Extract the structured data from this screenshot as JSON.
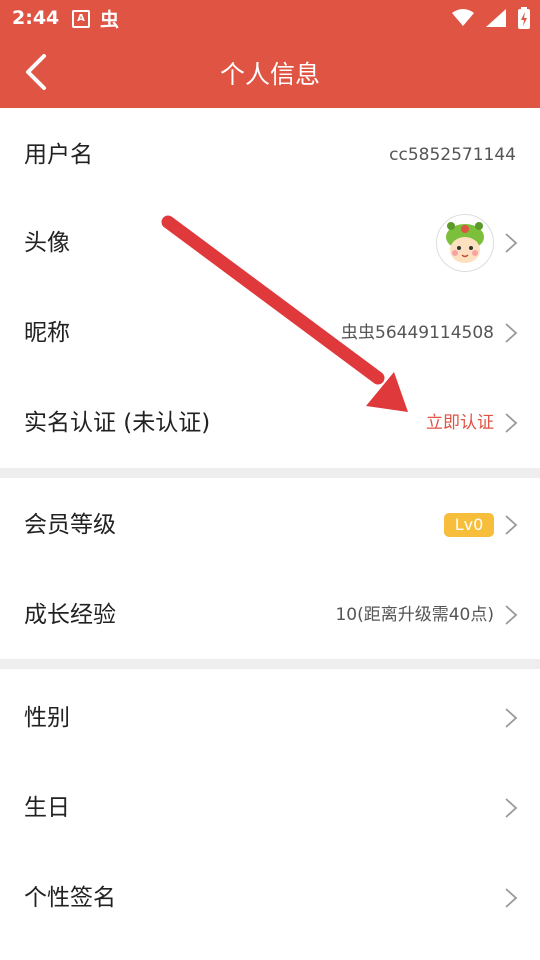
{
  "status_bar": {
    "time": "2:44",
    "app_icon_letter": "A",
    "app_icon2": "虫"
  },
  "header": {
    "title": "个人信息",
    "accent_color": "#e05444"
  },
  "rows": {
    "username": {
      "label": "用户名",
      "value": "cc5852571144"
    },
    "avatar": {
      "label": "头像"
    },
    "nickname": {
      "label": "昵称",
      "value": "虫虫56449114508"
    },
    "realname": {
      "label": "实名认证 (未认证)",
      "value": "立即认证"
    },
    "vip_level": {
      "label": "会员等级",
      "value": "Lv0"
    },
    "growth": {
      "label": "成长经验",
      "value": "10(距离升级需40点)"
    },
    "gender": {
      "label": "性别"
    },
    "birthday": {
      "label": "生日"
    },
    "signature": {
      "label": "个性签名"
    }
  },
  "icons": {
    "back": "chevron-left-icon",
    "row_arrow": "chevron-right-icon",
    "annotation": "red-arrow-annotation"
  }
}
